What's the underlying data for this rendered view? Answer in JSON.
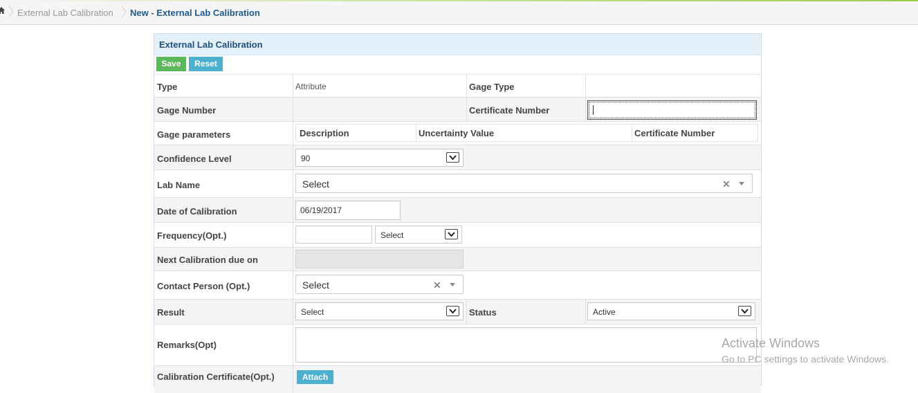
{
  "breadcrumb": {
    "items": [
      "External Lab Calibration",
      "New - External Lab Calibration"
    ]
  },
  "panel": {
    "title": "External Lab Calibration",
    "save_label": "Save",
    "reset_label": "Reset"
  },
  "form": {
    "type_label": "Type",
    "type_value": "Attribute",
    "gage_type_label": "Gage Type",
    "gage_number_label": "Gage Number",
    "certificate_number_label": "Certificate Number",
    "gage_parameters_label": "Gage parameters",
    "params_headers": [
      "Description",
      "Uncertainty Value",
      "Certificate Number"
    ],
    "confidence_level_label": "Confidence Level",
    "confidence_level_value": "90",
    "lab_name_label": "Lab Name",
    "lab_name_value": "Select",
    "date_label": "Date of Calibration",
    "date_value": "06/19/2017",
    "frequency_label": "Frequency(Opt.)",
    "frequency_unit_value": "Select",
    "next_due_label": "Next Calibration due on",
    "contact_label": "Contact Person (Opt.)",
    "contact_value": "Select",
    "result_label": "Result",
    "result_value": "Select",
    "status_label": "Status",
    "status_value": "Active",
    "remarks_label": "Remarks(Opt)",
    "certificate_label": "Calibration Certificate(Opt.)",
    "attach_label": "Attach"
  },
  "watermark": {
    "line1": "Activate Windows",
    "line2": "Go to PC settings to activate Windows."
  },
  "colors": {
    "accent": "#1c5080",
    "save": "#5cb85c",
    "reset": "#4bb1cf"
  }
}
